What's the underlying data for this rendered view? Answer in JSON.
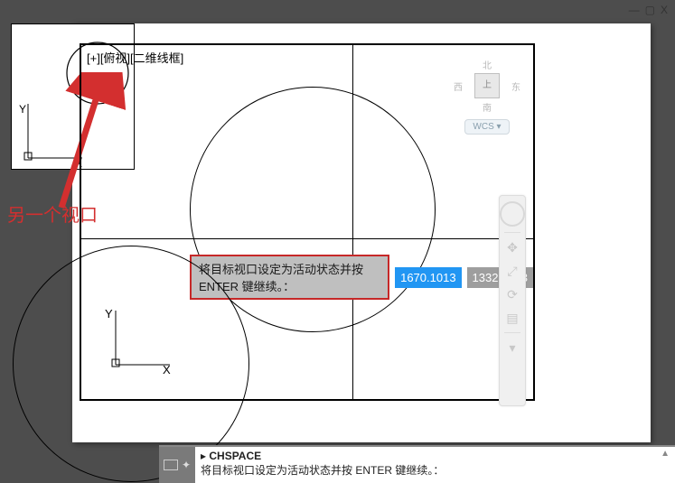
{
  "window_controls": {
    "min": "—",
    "max": "▢",
    "close": "X"
  },
  "small_viewport": {},
  "main_viewport": {
    "label": "[+][俯视][二维线框]"
  },
  "prompt": {
    "text": "将目标视口设定为活动状态并按 ENTER 键继续。：",
    "coord_x": "1670.1013",
    "coord_y": "1332.6743"
  },
  "viewcube": {
    "north": "北",
    "south": "南",
    "east": "东",
    "west": "西",
    "top": "上",
    "wcs": "WCS  ▾"
  },
  "ucs": {
    "x": "X",
    "y": "Y"
  },
  "callout": "另一个视口",
  "command_line": {
    "name": "CHSPACE",
    "prompt": "将目标视口设定为活动状态并按 ENTER 键继续。："
  }
}
